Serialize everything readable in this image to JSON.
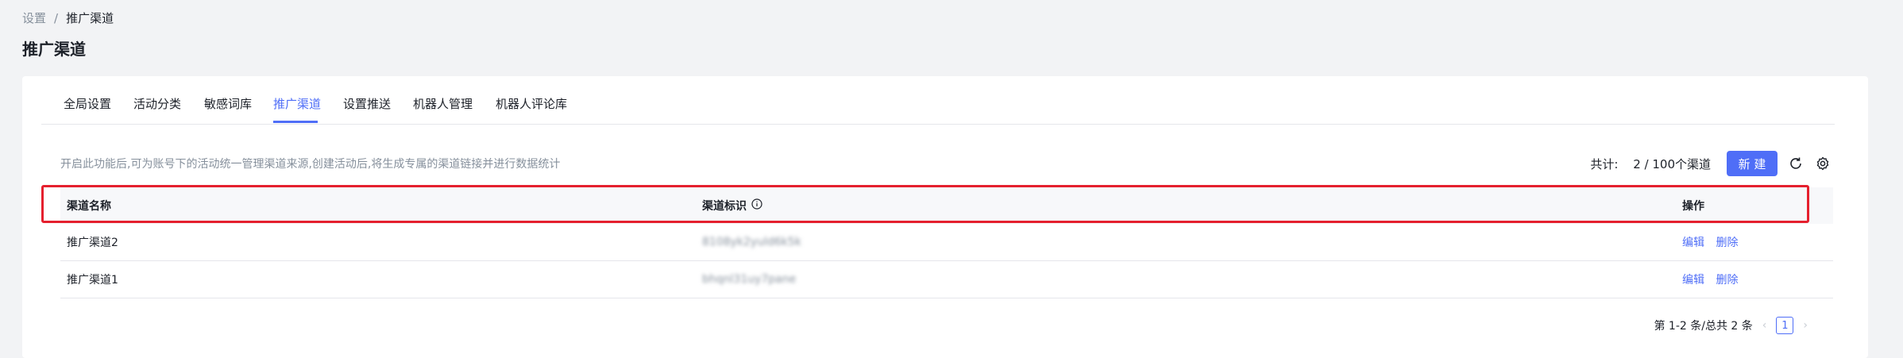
{
  "breadcrumb": {
    "root": "设置",
    "sep": "/",
    "current": "推广渠道"
  },
  "page_title": "推广渠道",
  "tabs": [
    {
      "label": "全局设置"
    },
    {
      "label": "活动分类"
    },
    {
      "label": "敏感词库"
    },
    {
      "label": "推广渠道",
      "active": true
    },
    {
      "label": "设置推送"
    },
    {
      "label": "机器人管理"
    },
    {
      "label": "机器人评论库"
    }
  ],
  "description": "开启此功能后,可为账号下的活动统一管理渠道来源,创建活动后,将生成专属的渠道链接并进行数据统计",
  "toolbar": {
    "total_label": "共计:",
    "total_value": "2 / 100个渠道",
    "new_button": "新 建",
    "refresh_icon": "refresh-icon",
    "settings_icon": "gear-icon"
  },
  "table": {
    "headers": {
      "name": "渠道名称",
      "id": "渠道标识",
      "actions": "操作"
    },
    "rows": [
      {
        "name": "推广渠道2",
        "id": "8108yk2yuld6k5k",
        "edit": "编辑",
        "delete": "删除"
      },
      {
        "name": "推广渠道1",
        "id": "bhqnl31uy7pane",
        "edit": "编辑",
        "delete": "删除"
      }
    ]
  },
  "pagination": {
    "summary": "第 1-2 条/总共 2 条",
    "current_page": "1"
  },
  "colors": {
    "accent": "#4f6ef7",
    "highlight": "#e5202e"
  }
}
